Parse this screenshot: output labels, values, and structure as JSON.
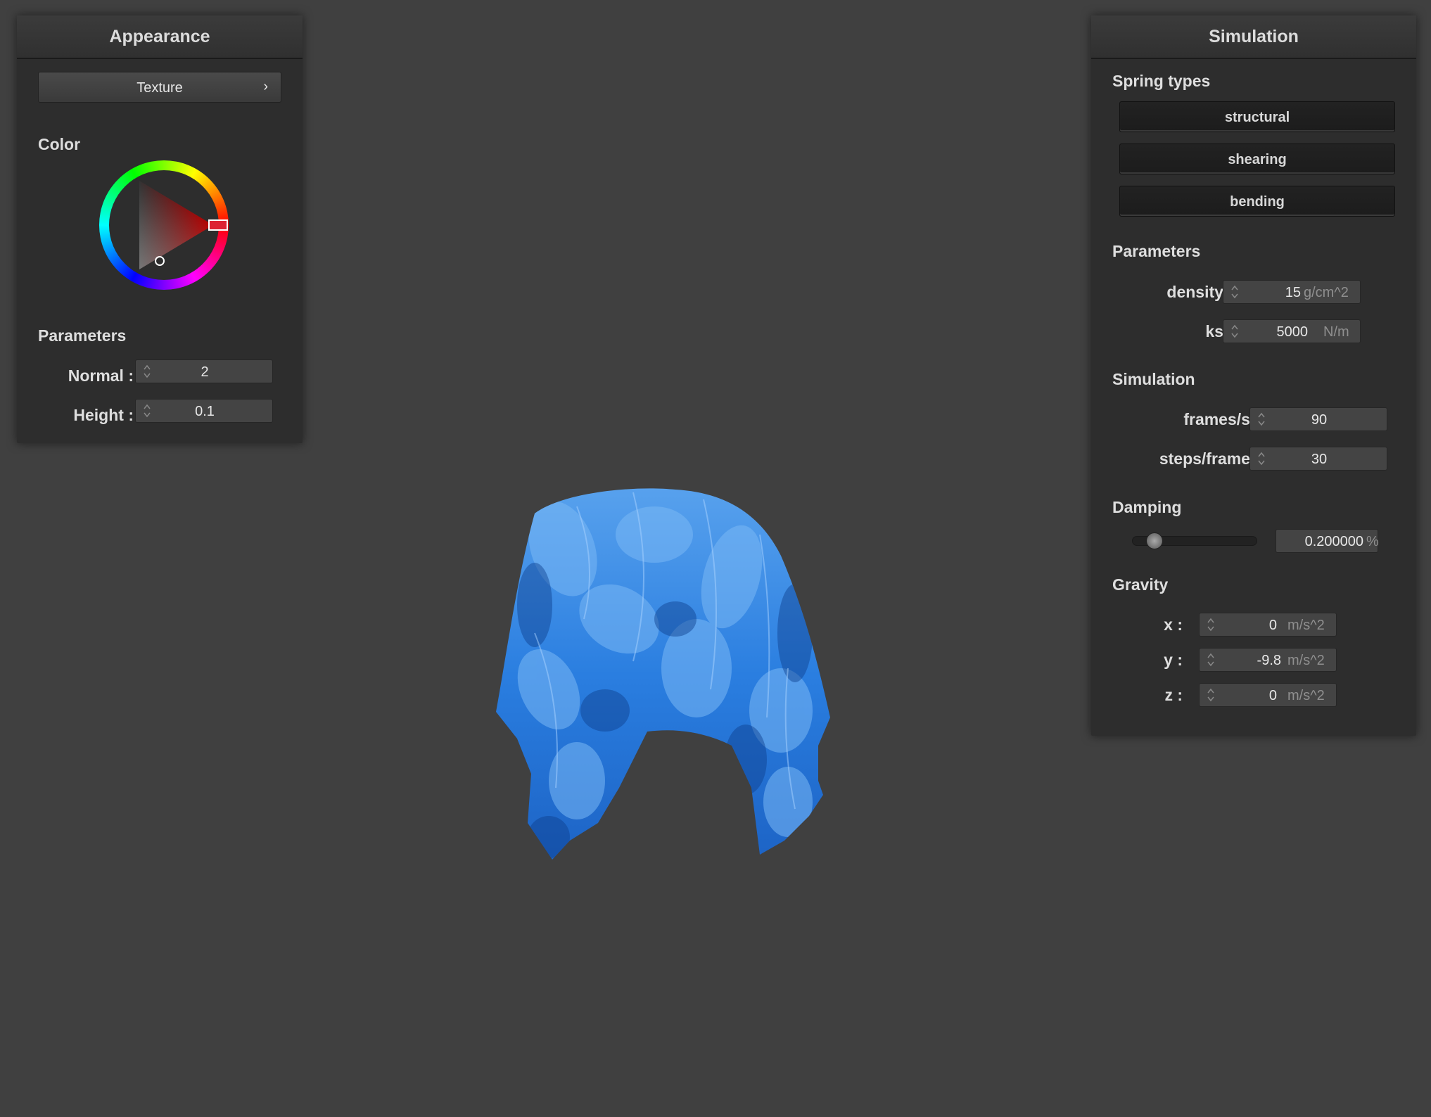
{
  "appearance": {
    "title": "Appearance",
    "texture_button": "Texture",
    "texture_chevron": "›",
    "color_label": "Color",
    "color_wheel": {
      "hue": "#ff0000",
      "icon": "color-wheel"
    },
    "params_label": "Parameters",
    "normal": {
      "label": "Normal :",
      "value": "2"
    },
    "height": {
      "label": "Height :",
      "value": "0.1"
    }
  },
  "simulation": {
    "title": "Simulation",
    "spring_types_label": "Spring types",
    "springs": [
      "structural",
      "shearing",
      "bending"
    ],
    "params_label": "Parameters",
    "density": {
      "label": "density :",
      "value": "15",
      "unit": "g/cm^2"
    },
    "ks": {
      "label": "ks :",
      "value": "5000",
      "unit": "N/m"
    },
    "sim_label": "Simulation",
    "fps": {
      "label": "frames/s :",
      "value": "90"
    },
    "steps": {
      "label": "steps/frame :",
      "value": "30"
    },
    "damping_label": "Damping",
    "damping": {
      "value": "0.200000",
      "unit": "%",
      "slider_fraction": 0.2
    },
    "gravity_label": "Gravity",
    "gx": {
      "label": "x :",
      "value": "0",
      "unit": "m/s^2"
    },
    "gy": {
      "label": "y :",
      "value": "-9.8",
      "unit": "m/s^2"
    },
    "gz": {
      "label": "z :",
      "value": "0",
      "unit": "m/s^2"
    }
  },
  "viewport": {
    "object": "cloth-draped-sphere",
    "texture": "blue-hydrangea-petals",
    "color": "#2a7ee0"
  }
}
